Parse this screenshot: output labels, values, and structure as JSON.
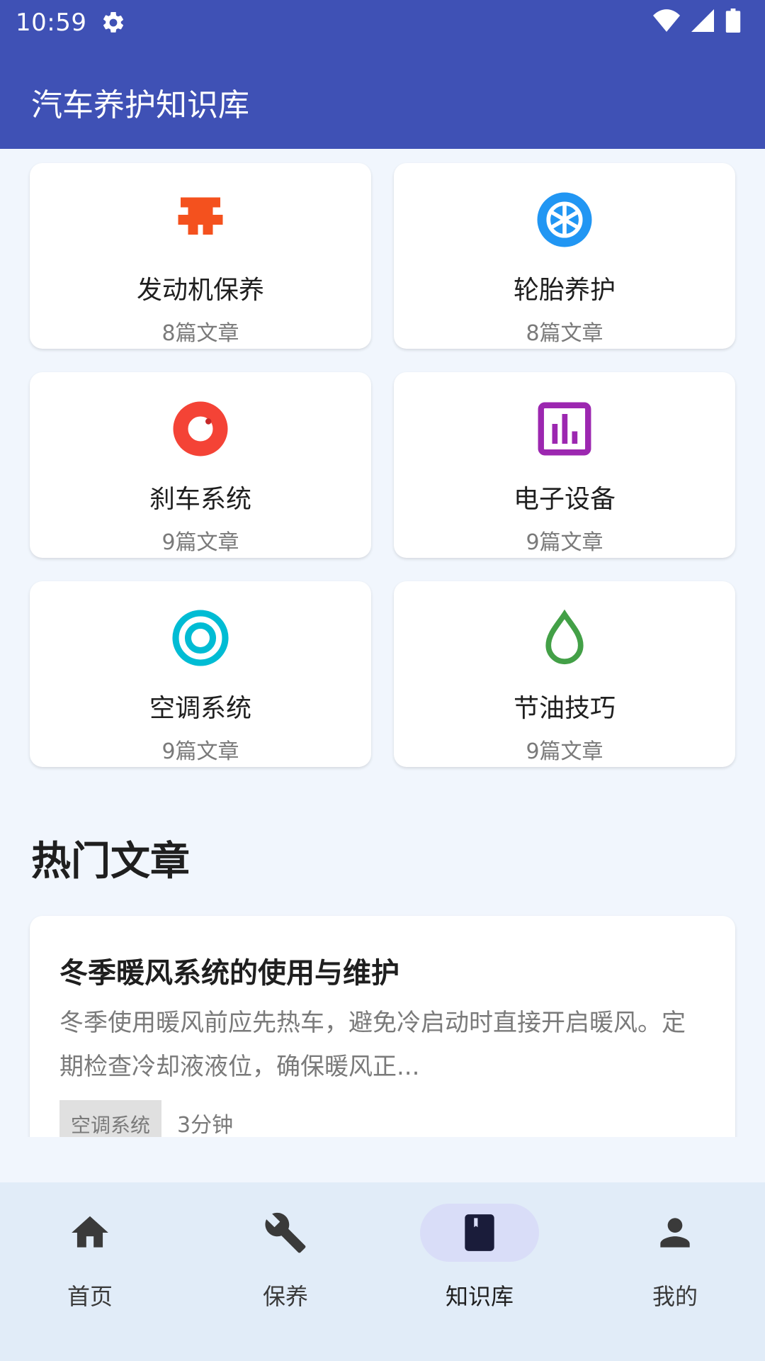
{
  "status_bar": {
    "time": "10:59",
    "icons": [
      "settings-gear-icon",
      "wifi-icon",
      "signal-icon",
      "battery-icon"
    ]
  },
  "app_bar": {
    "title": "汽车养护知识库"
  },
  "categories": [
    {
      "title": "发动机保养",
      "count": "8篇文章",
      "icon": "engine-icon",
      "color": "#F4511E"
    },
    {
      "title": "轮胎养护",
      "count": "8篇文章",
      "icon": "tire-icon",
      "color": "#2196F3"
    },
    {
      "title": "刹车系统",
      "count": "9篇文章",
      "icon": "brake-icon",
      "color": "#F44336"
    },
    {
      "title": "电子设备",
      "count": "9篇文章",
      "icon": "chart-icon",
      "color": "#9C27B0"
    },
    {
      "title": "空调系统",
      "count": "9篇文章",
      "icon": "ac-icon",
      "color": "#00BCD4"
    },
    {
      "title": "节油技巧",
      "count": "9篇文章",
      "icon": "drop-icon",
      "color": "#43A047"
    }
  ],
  "hot_articles": {
    "section_title": "热门文章",
    "items": [
      {
        "title": "冬季暖风系统的使用与维护",
        "excerpt": "冬季使用暖风前应先热车，避免冷启动时直接开启暖风。定期检查冷却液液位，确保暖风正...",
        "tag": "空调系统",
        "read_time": "3分钟"
      }
    ]
  },
  "bottom_nav": {
    "items": [
      {
        "label": "首页",
        "icon": "home-icon",
        "active": false
      },
      {
        "label": "保养",
        "icon": "wrench-icon",
        "active": false
      },
      {
        "label": "知识库",
        "icon": "book-icon",
        "active": true
      },
      {
        "label": "我的",
        "icon": "person-icon",
        "active": false
      }
    ]
  }
}
